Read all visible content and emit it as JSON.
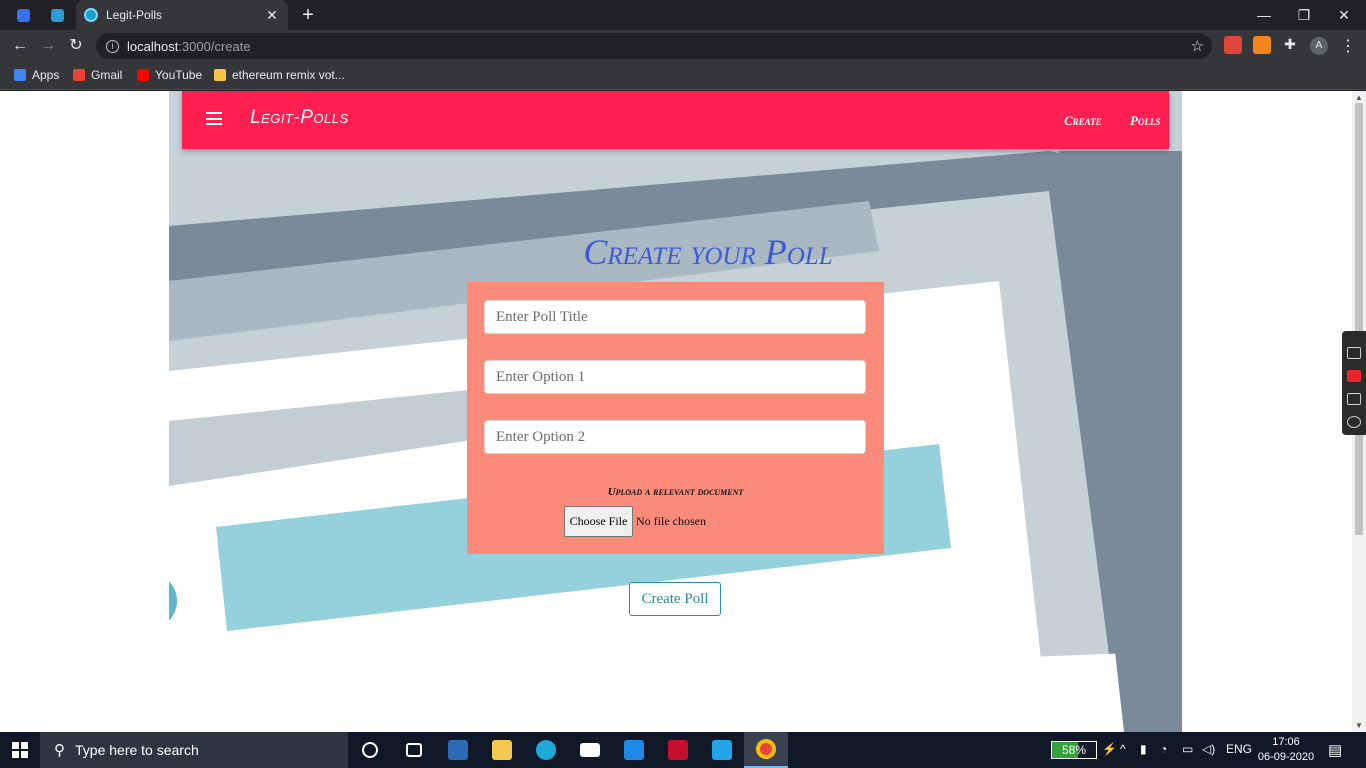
{
  "browser": {
    "tab_title": "Legit-Polls",
    "url_host": "localhost",
    "url_path": ":3000/create",
    "profile_initial": "A",
    "bookmarks": [
      "Apps",
      "Gmail",
      "YouTube",
      "ethereum remix vot..."
    ]
  },
  "app": {
    "brand": "Legit-Polls",
    "nav_links": [
      "Create",
      "Polls"
    ],
    "heading": "Create your Poll",
    "form": {
      "title_placeholder": "Enter Poll Title",
      "option1_placeholder": "Enter Option 1",
      "option2_placeholder": "Enter Option 2",
      "upload_label": "Upload a relevant document",
      "choose_file": "Choose File",
      "no_file": "No file chosen"
    },
    "submit_label": "Create Poll",
    "colors": {
      "navbar": "#ff1f50",
      "form_bg": "#fa8a7a",
      "heading": "#3b5bd6",
      "button": "#2a8aa0"
    }
  },
  "taskbar": {
    "search_placeholder": "Type here to search",
    "battery": "58%",
    "battery_level": 0.58,
    "lang": "ENG",
    "time": "17:06",
    "date": "06-09-2020"
  }
}
